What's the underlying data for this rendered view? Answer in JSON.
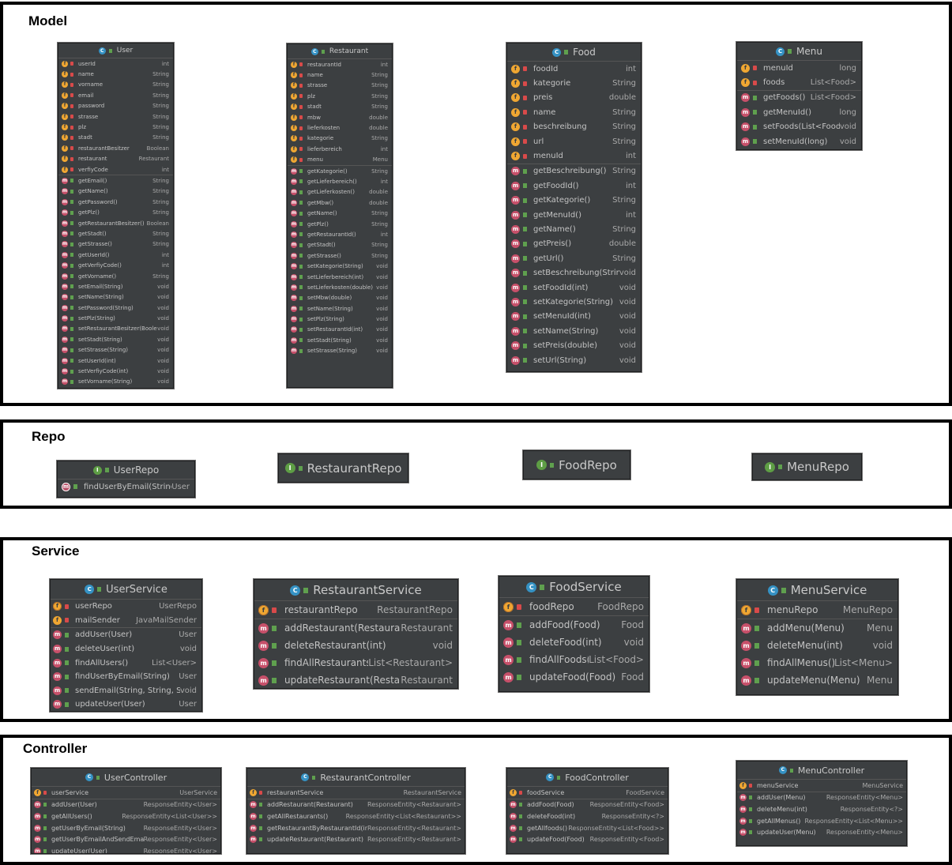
{
  "sections": {
    "model": "Model",
    "repo": "Repo",
    "service": "Service",
    "controller": "Controller"
  },
  "colors": {
    "card_bg": "#3c3f41",
    "class_badge": "#3592c4",
    "interface_badge": "#5e9e45",
    "field_badge": "#f0a732",
    "method_badge": "#c7506a",
    "private_lock": "#d84a4a",
    "public_marker": "#5fa04e"
  },
  "classes": {
    "user": {
      "name": "User",
      "fields": [
        {
          "name": "userId",
          "type": "int"
        },
        {
          "name": "name",
          "type": "String"
        },
        {
          "name": "vorname",
          "type": "String"
        },
        {
          "name": "email",
          "type": "String"
        },
        {
          "name": "password",
          "type": "String"
        },
        {
          "name": "strasse",
          "type": "String"
        },
        {
          "name": "plz",
          "type": "String"
        },
        {
          "name": "stadt",
          "type": "String"
        },
        {
          "name": "restaurantBesitzer",
          "type": "Boolean"
        },
        {
          "name": "restaurant",
          "type": "Restaurant"
        },
        {
          "name": "verfiyCode",
          "type": "int"
        }
      ],
      "methods": [
        {
          "name": "getEmail()",
          "type": "String"
        },
        {
          "name": "getName()",
          "type": "String"
        },
        {
          "name": "getPassword()",
          "type": "String"
        },
        {
          "name": "getPlz()",
          "type": "String"
        },
        {
          "name": "getRestaurantBesitzer()",
          "type": "Boolean"
        },
        {
          "name": "getStadt()",
          "type": "String"
        },
        {
          "name": "getStrasse()",
          "type": "String"
        },
        {
          "name": "getUserId()",
          "type": "int"
        },
        {
          "name": "getVerfiyCode()",
          "type": "int"
        },
        {
          "name": "getVorname()",
          "type": "String"
        },
        {
          "name": "setEmail(String)",
          "type": "void"
        },
        {
          "name": "setName(String)",
          "type": "void"
        },
        {
          "name": "setPassword(String)",
          "type": "void"
        },
        {
          "name": "setPlz(String)",
          "type": "void"
        },
        {
          "name": "setRestaurantBesitzer(Boolean)",
          "type": "void"
        },
        {
          "name": "setStadt(String)",
          "type": "void"
        },
        {
          "name": "setStrasse(String)",
          "type": "void"
        },
        {
          "name": "setUserId(int)",
          "type": "void"
        },
        {
          "name": "setVerfiyCode(int)",
          "type": "void"
        },
        {
          "name": "setVorname(String)",
          "type": "void"
        }
      ]
    },
    "restaurant": {
      "name": "Restaurant",
      "fields": [
        {
          "name": "restaurantId",
          "type": "int"
        },
        {
          "name": "name",
          "type": "String"
        },
        {
          "name": "strasse",
          "type": "String"
        },
        {
          "name": "plz",
          "type": "String"
        },
        {
          "name": "stadt",
          "type": "String"
        },
        {
          "name": "mbw",
          "type": "double"
        },
        {
          "name": "lieferkosten",
          "type": "double"
        },
        {
          "name": "kategorie",
          "type": "String"
        },
        {
          "name": "lieferbereich",
          "type": "int"
        },
        {
          "name": "menu",
          "type": "Menu"
        }
      ],
      "methods": [
        {
          "name": "getKategorie()",
          "type": "String"
        },
        {
          "name": "getLieferbereich()",
          "type": "int"
        },
        {
          "name": "getLieferkosten()",
          "type": "double"
        },
        {
          "name": "getMbw()",
          "type": "double"
        },
        {
          "name": "getName()",
          "type": "String"
        },
        {
          "name": "getPlz()",
          "type": "String"
        },
        {
          "name": "getRestaurantId()",
          "type": "int"
        },
        {
          "name": "getStadt()",
          "type": "String"
        },
        {
          "name": "getStrasse()",
          "type": "String"
        },
        {
          "name": "setKategorie(String)",
          "type": "void"
        },
        {
          "name": "setLieferbereich(int)",
          "type": "void"
        },
        {
          "name": "setLieferkosten(double)",
          "type": "void"
        },
        {
          "name": "setMbw(double)",
          "type": "void"
        },
        {
          "name": "setName(String)",
          "type": "void"
        },
        {
          "name": "setPlz(String)",
          "type": "void"
        },
        {
          "name": "setRestaurantId(int)",
          "type": "void"
        },
        {
          "name": "setStadt(String)",
          "type": "void"
        },
        {
          "name": "setStrasse(String)",
          "type": "void"
        }
      ]
    },
    "food": {
      "name": "Food",
      "fields": [
        {
          "name": "foodId",
          "type": "int"
        },
        {
          "name": "kategorie",
          "type": "String"
        },
        {
          "name": "preis",
          "type": "double"
        },
        {
          "name": "name",
          "type": "String"
        },
        {
          "name": "beschreibung",
          "type": "String"
        },
        {
          "name": "url",
          "type": "String"
        },
        {
          "name": "menuId",
          "type": "int"
        }
      ],
      "methods": [
        {
          "name": "getBeschreibung()",
          "type": "String"
        },
        {
          "name": "getFoodId()",
          "type": "int"
        },
        {
          "name": "getKategorie()",
          "type": "String"
        },
        {
          "name": "getMenuId()",
          "type": "int"
        },
        {
          "name": "getName()",
          "type": "String"
        },
        {
          "name": "getPreis()",
          "type": "double"
        },
        {
          "name": "getUrl()",
          "type": "String"
        },
        {
          "name": "setBeschreibung(String)",
          "type": "void"
        },
        {
          "name": "setFoodId(int)",
          "type": "void"
        },
        {
          "name": "setKategorie(String)",
          "type": "void"
        },
        {
          "name": "setMenuId(int)",
          "type": "void"
        },
        {
          "name": "setName(String)",
          "type": "void"
        },
        {
          "name": "setPreis(double)",
          "type": "void"
        },
        {
          "name": "setUrl(String)",
          "type": "void"
        }
      ]
    },
    "menu": {
      "name": "Menu",
      "fields": [
        {
          "name": "menuId",
          "type": "long"
        },
        {
          "name": "foods",
          "type": "List<Food>"
        }
      ],
      "methods": [
        {
          "name": "getFoods()",
          "type": "List<Food>"
        },
        {
          "name": "getMenuId()",
          "type": "long"
        },
        {
          "name": "setFoods(List<Food>)",
          "type": "void"
        },
        {
          "name": "setMenuId(long)",
          "type": "void"
        }
      ]
    },
    "user_repo": {
      "name": "UserRepo",
      "fields": [],
      "methods": [
        {
          "name": "findUserByEmail(String)",
          "type": "User"
        }
      ]
    },
    "restaurant_repo": {
      "name": "RestaurantRepo",
      "fields": [],
      "methods": []
    },
    "food_repo": {
      "name": "FoodRepo",
      "fields": [],
      "methods": []
    },
    "menu_repo": {
      "name": "MenuRepo",
      "fields": [],
      "methods": []
    },
    "user_service": {
      "name": "UserService",
      "fields": [
        {
          "name": "userRepo",
          "type": "UserRepo"
        },
        {
          "name": "mailSender",
          "type": "JavaMailSender"
        }
      ],
      "methods": [
        {
          "name": "addUser(User)",
          "type": "User"
        },
        {
          "name": "deleteUser(int)",
          "type": "void"
        },
        {
          "name": "findAllUsers()",
          "type": "List<User>"
        },
        {
          "name": "findUserByEmail(String)",
          "type": "User"
        },
        {
          "name": "sendEmail(String, String, String)",
          "type": "void"
        },
        {
          "name": "updateUser(User)",
          "type": "User"
        }
      ]
    },
    "restaurant_service": {
      "name": "RestaurantService",
      "fields": [
        {
          "name": "restaurantRepo",
          "type": "RestaurantRepo"
        }
      ],
      "methods": [
        {
          "name": "addRestaurant(Restaurant)",
          "type": "Restaurant"
        },
        {
          "name": "deleteRestaurant(int)",
          "type": "void"
        },
        {
          "name": "findAllRestaurants()",
          "type": "List<Restaurant>"
        },
        {
          "name": "updateRestaurant(Restaurant)",
          "type": "Restaurant"
        }
      ]
    },
    "food_service": {
      "name": "FoodService",
      "fields": [
        {
          "name": "foodRepo",
          "type": "FoodRepo"
        }
      ],
      "methods": [
        {
          "name": "addFood(Food)",
          "type": "Food"
        },
        {
          "name": "deleteFood(int)",
          "type": "void"
        },
        {
          "name": "findAllFoods()",
          "type": "List<Food>"
        },
        {
          "name": "updateFood(Food)",
          "type": "Food"
        }
      ]
    },
    "menu_service": {
      "name": "MenuService",
      "fields": [
        {
          "name": "menuRepo",
          "type": "MenuRepo"
        }
      ],
      "methods": [
        {
          "name": "addMenu(Menu)",
          "type": "Menu"
        },
        {
          "name": "deleteMenu(int)",
          "type": "void"
        },
        {
          "name": "findAllMenus()",
          "type": "List<Menu>"
        },
        {
          "name": "updateMenu(Menu)",
          "type": "Menu"
        }
      ]
    },
    "user_controller": {
      "name": "UserController",
      "fields": [
        {
          "name": "userService",
          "type": "UserService"
        }
      ],
      "methods": [
        {
          "name": "addUser(User)",
          "type": "ResponseEntity<User>"
        },
        {
          "name": "getAllUsers()",
          "type": "ResponseEntity<List<User>>"
        },
        {
          "name": "getUserByEmail(String)",
          "type": "ResponseEntity<User>"
        },
        {
          "name": "getUserByEmailAndSendEmail(String)",
          "type": "ResponseEntity<User>"
        },
        {
          "name": "updateUser(User)",
          "type": "ResponseEntity<User>"
        }
      ]
    },
    "restaurant_controller": {
      "name": "RestaurantController",
      "fields": [
        {
          "name": "restaurantService",
          "type": "RestaurantService"
        }
      ],
      "methods": [
        {
          "name": "addRestaurant(Restaurant)",
          "type": "ResponseEntity<Restaurant>"
        },
        {
          "name": "getAllRestaurants()",
          "type": "ResponseEntity<List<Restaurant>>"
        },
        {
          "name": "getRestaurantByRestaurantId(int)",
          "type": "ResponseEntity<Restaurant>"
        },
        {
          "name": "updateRestaurant(Restaurant)",
          "type": "ResponseEntity<Restaurant>"
        }
      ]
    },
    "food_controller": {
      "name": "FoodController",
      "fields": [
        {
          "name": "foodService",
          "type": "FoodService"
        }
      ],
      "methods": [
        {
          "name": "addFood(Food)",
          "type": "ResponseEntity<Food>"
        },
        {
          "name": "deleteFood(int)",
          "type": "ResponseEntity<?>"
        },
        {
          "name": "getAllfoods()",
          "type": "ResponseEntity<List<Food>>"
        },
        {
          "name": "updateFood(Food)",
          "type": "ResponseEntity<Food>"
        }
      ]
    },
    "menu_controller": {
      "name": "MenuController",
      "fields": [
        {
          "name": "menuService",
          "type": "MenuService"
        }
      ],
      "methods": [
        {
          "name": "addUser(Menu)",
          "type": "ResponseEntity<Menu>"
        },
        {
          "name": "deleteMenu(int)",
          "type": "ResponseEntity<?>"
        },
        {
          "name": "getAllMenus()",
          "type": "ResponseEntity<List<Menu>>"
        },
        {
          "name": "updateUser(Menu)",
          "type": "ResponseEntity<Menu>"
        }
      ]
    }
  }
}
